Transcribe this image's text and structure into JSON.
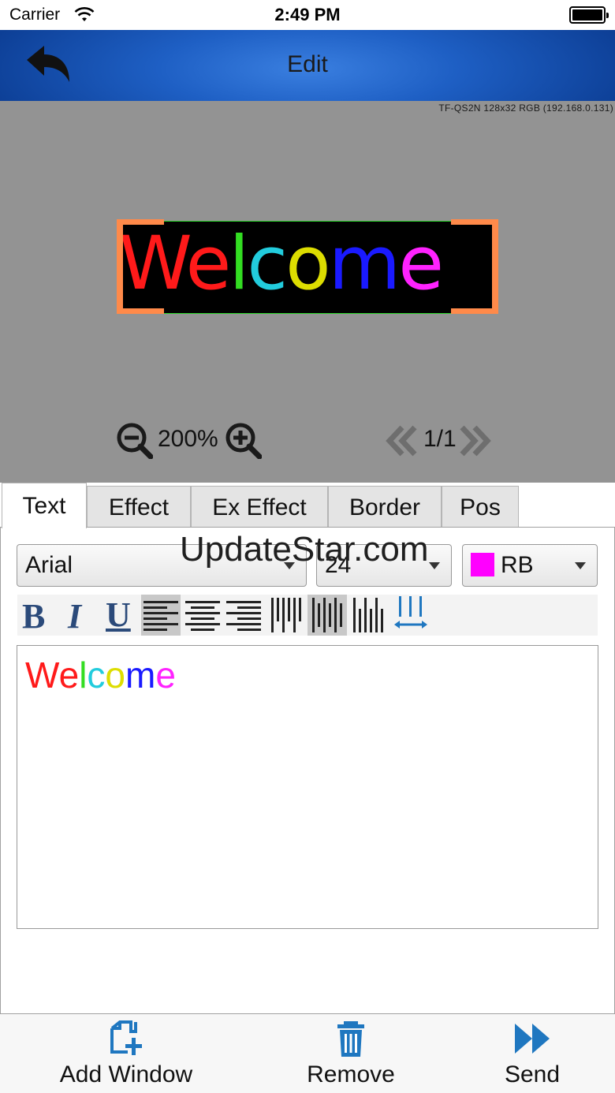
{
  "status_bar": {
    "carrier": "Carrier",
    "time": "2:49 PM"
  },
  "nav": {
    "title": "Edit",
    "back_icon": "back-arrow-icon"
  },
  "preview": {
    "device_info": "TF-QS2N 128x32 RGB (192.168.0.131)",
    "zoom_level": "200%",
    "page_indicator": "1/1",
    "led_letters": [
      {
        "char": "W",
        "color": "#ff1a1a"
      },
      {
        "char": "e",
        "color": "#ff1a1a"
      },
      {
        "char": "l",
        "color": "#33dd22"
      },
      {
        "char": "c",
        "color": "#22ccdd"
      },
      {
        "char": "o",
        "color": "#dddd00"
      },
      {
        "char": "m",
        "color": "#1a1aff"
      },
      {
        "char": "e",
        "color": "#ff22ff"
      }
    ]
  },
  "tabs": [
    {
      "label": "Text",
      "active": true
    },
    {
      "label": "Effect",
      "active": false
    },
    {
      "label": "Ex Effect",
      "active": false
    },
    {
      "label": "Border",
      "active": false
    },
    {
      "label": "Pos",
      "active": false
    }
  ],
  "font": {
    "family": "Arial",
    "size": "24",
    "color_label": "RB",
    "color_swatch": "#ff00ff"
  },
  "toolbar": {
    "bold_label": "B",
    "italic_label": "I",
    "underline_label": "U",
    "selected": [
      "align-left",
      "valign-middle"
    ]
  },
  "editor": {
    "letters": [
      {
        "char": "W",
        "color": "#ff1a1a"
      },
      {
        "char": "e",
        "color": "#ff1a1a"
      },
      {
        "char": "l",
        "color": "#33dd22"
      },
      {
        "char": "c",
        "color": "#22ccdd"
      },
      {
        "char": "o",
        "color": "#dddd00"
      },
      {
        "char": "m",
        "color": "#1a1aff"
      },
      {
        "char": "e",
        "color": "#ff22ff"
      }
    ]
  },
  "watermark": "UpdateStar.com",
  "bottom_bar": {
    "add_window": "Add Window",
    "remove": "Remove",
    "send": "Send"
  },
  "colors": {
    "accent": "#1f77c0",
    "nav_blue": "#1e5fc4",
    "handle": "#ff8a4a"
  }
}
